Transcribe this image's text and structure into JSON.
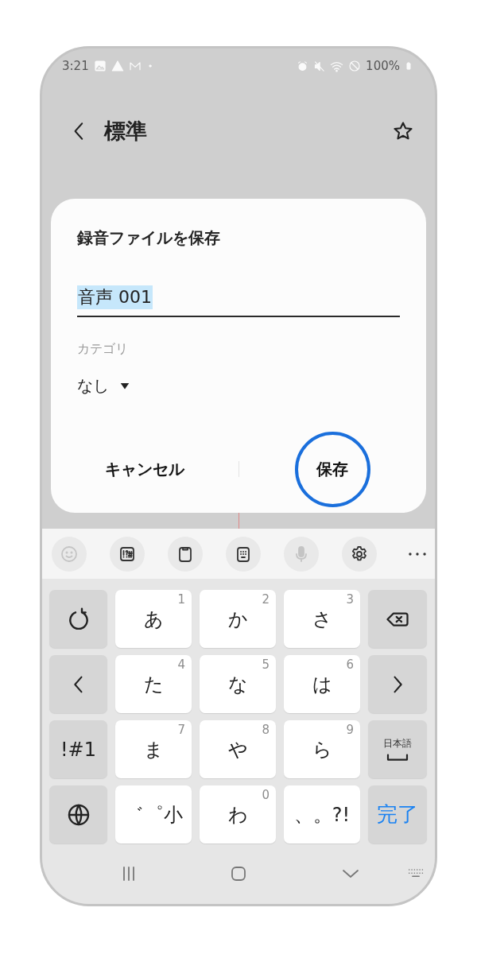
{
  "status_bar": {
    "time": "3:21",
    "battery": "100%"
  },
  "app_bar": {
    "title": "標準"
  },
  "dialog": {
    "title": "録音ファイルを保存",
    "name_field": {
      "value": "音声 001",
      "text_selected": true
    },
    "category": {
      "label": "カテゴリ",
      "value": "なし"
    },
    "buttons": [
      {
        "label": "キャンセル",
        "highlighted": false
      },
      {
        "label": "保存",
        "highlighted": true
      }
    ]
  },
  "keyboard": {
    "toolbar": [
      {
        "kind": "emoji",
        "disabled": true
      },
      {
        "kind": "symbols",
        "disabled": false
      },
      {
        "kind": "clipboard",
        "disabled": false
      },
      {
        "kind": "keypad",
        "disabled": false
      },
      {
        "kind": "mic",
        "disabled": true
      },
      {
        "kind": "settings",
        "disabled": false
      },
      {
        "kind": "more",
        "disabled": false
      }
    ],
    "rows": [
      [
        {
          "kind": "undo"
        },
        {
          "kind": "char",
          "label": "あ",
          "number": "1"
        },
        {
          "kind": "char",
          "label": "か",
          "number": "2"
        },
        {
          "kind": "char",
          "label": "さ",
          "number": "3"
        },
        {
          "kind": "backspace"
        }
      ],
      [
        {
          "kind": "left"
        },
        {
          "kind": "char",
          "label": "た",
          "number": "4"
        },
        {
          "kind": "char",
          "label": "な",
          "number": "5"
        },
        {
          "kind": "char",
          "label": "は",
          "number": "6"
        },
        {
          "kind": "right"
        }
      ],
      [
        {
          "kind": "mode",
          "label": "!#1"
        },
        {
          "kind": "char",
          "label": "ま",
          "number": "7"
        },
        {
          "kind": "char",
          "label": "や",
          "number": "8"
        },
        {
          "kind": "char",
          "label": "ら",
          "number": "9"
        },
        {
          "kind": "space",
          "label": "日本語"
        }
      ],
      [
        {
          "kind": "globe"
        },
        {
          "kind": "char",
          "label": "゛゜小"
        },
        {
          "kind": "char",
          "label": "わ",
          "number": "0"
        },
        {
          "kind": "char",
          "label": "、。?!"
        },
        {
          "kind": "done",
          "label": "完了"
        }
      ]
    ]
  }
}
